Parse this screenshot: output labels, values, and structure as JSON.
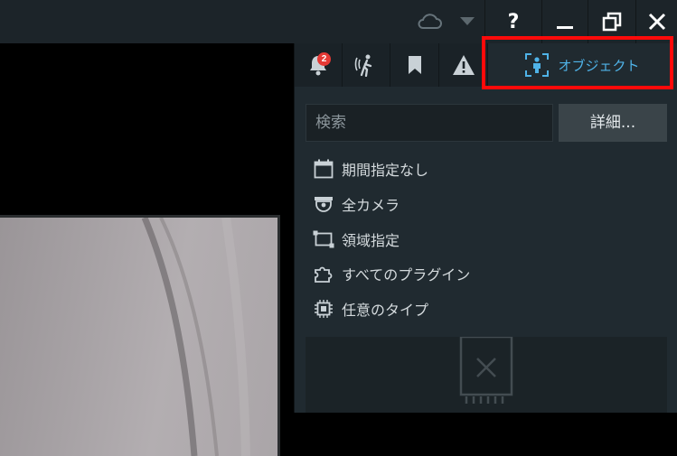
{
  "titlebar": {
    "help_label": "?",
    "icons": [
      "cloud-icon",
      "dropdown-triangle-icon",
      "minimize-icon",
      "restore-icon",
      "close-icon"
    ]
  },
  "tabs": {
    "notifications_badge": "2",
    "object_label": "オブジェクト"
  },
  "search": {
    "placeholder": "検索",
    "detail_label": "詳細..."
  },
  "filters": [
    {
      "icon": "calendar-icon",
      "label": "期間指定なし"
    },
    {
      "icon": "camera-icon",
      "label": "全カメラ"
    },
    {
      "icon": "area-select-icon",
      "label": "領域指定"
    },
    {
      "icon": "plugin-puzzle-icon",
      "label": "すべてのプラグイン"
    },
    {
      "icon": "chip-icon",
      "label": "任意のタイプ"
    }
  ],
  "colors": {
    "accent": "#4fb3e8",
    "badge": "#e53935",
    "highlight": "#ff0a0a",
    "panel_bg": "#202a30"
  }
}
